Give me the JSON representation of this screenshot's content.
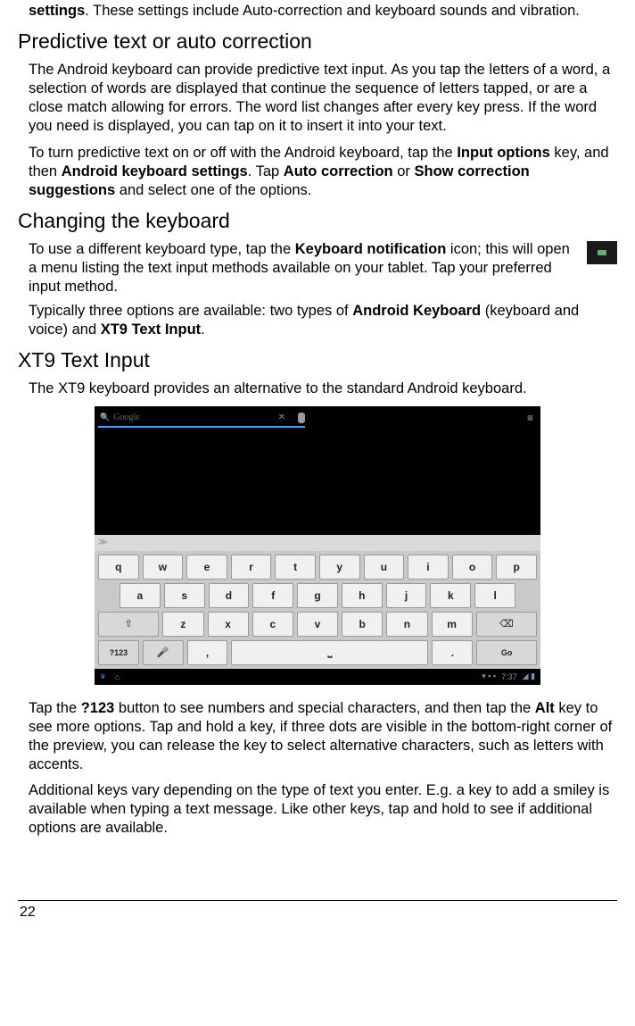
{
  "intro": {
    "settings": "settings",
    "rest": ". These settings include Auto-correction and keyboard sounds and vibration."
  },
  "predictive": {
    "heading": "Predictive text or auto correction",
    "p1": "The Android keyboard can provide predictive text input. As you tap the letters of a word, a selection of words are displayed that continue the sequence of letters tapped, or are a close match allowing for errors. The word list changes after every key press. If the word you need is displayed, you can tap on it to insert it into your text.",
    "p2_a": "To turn predictive text on or off with the Android keyboard, tap the ",
    "p2_b1": "Input options",
    "p2_c": " key, and then ",
    "p2_b2": "Android keyboard settings",
    "p2_d": ". Tap ",
    "p2_b3": "Auto correction",
    "p2_e": " or ",
    "p2_b4": "Show correction suggestions",
    "p2_f": " and select one of the options."
  },
  "changing": {
    "heading": "Changing the keyboard",
    "p1_a": "To use a different keyboard type, tap the ",
    "p1_b1": "Keyboard notification",
    "p1_c": " icon; this will open a menu listing the text input methods available on your tablet. Tap your preferred input method.",
    "p2_a": "Typically three options are available: two types of ",
    "p2_b1": "Android Keyboard",
    "p2_c": " (keyboard and voice) and ",
    "p2_b2": "XT9 Text Input",
    "p2_d": "."
  },
  "xt9": {
    "heading": "XT9 Text Input",
    "p1": "The XT9 keyboard provides an alternative to the standard Android keyboard.",
    "p2_a": "Tap the ",
    "p2_b1": "?123",
    "p2_c": " button to see numbers and special characters, and then tap the ",
    "p2_b2": "Alt",
    "p2_d": " key to see more options. Tap and hold a key, if three dots are visible in the bottom-right corner of the preview, you can release the key to select alternative characters, such as letters with accents.",
    "p3": "Additional keys vary depending on the type of text you enter. E.g. a key to add a smiley is available when typing a text message. Like other keys, tap and hold to see if additional options are available."
  },
  "keyboard": {
    "search_placeholder": "Google",
    "row1": [
      "q",
      "w",
      "e",
      "r",
      "t",
      "y",
      "u",
      "i",
      "o",
      "p"
    ],
    "row2": [
      "a",
      "s",
      "d",
      "f",
      "g",
      "h",
      "j",
      "k",
      "l"
    ],
    "row3_letters": [
      "z",
      "x",
      "c",
      "v",
      "b",
      "n",
      "m"
    ],
    "shift": "⇧",
    "backspace": "⌫",
    "numkey": "?123",
    "mic": "🎤",
    "comma": ",",
    "period": ".",
    "go": "Go",
    "sugprefix": "≫",
    "menu": "≡",
    "nav_time": "7:37",
    "nav_v": "∨",
    "nav_home": "⌂",
    "nav_x": "✕"
  },
  "page_number": "22"
}
